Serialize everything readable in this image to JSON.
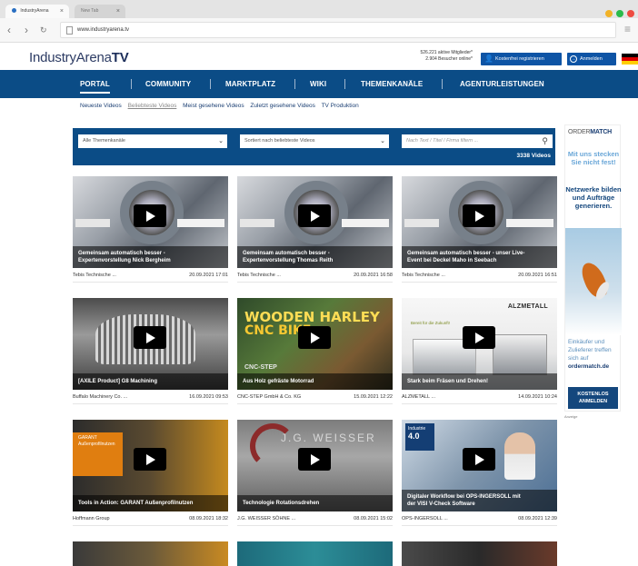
{
  "browser": {
    "tabs": [
      {
        "label": "IndustryArena"
      },
      {
        "label": "New Tab"
      }
    ],
    "url": "www.industryarena.tv",
    "window_buttons": [
      "#f2b227",
      "#2bbb4b",
      "#ee4b41"
    ]
  },
  "header": {
    "logo_text": "IndustryArena",
    "logo_suffix": "TV",
    "stats": {
      "members": "526.221 aktive Mitglieder*",
      "visitors": "2.904 Besucher online*"
    },
    "register_label": "Kostenfrei registrieren",
    "login_label": "Anmelden"
  },
  "nav": {
    "items": [
      {
        "label": "PORTAL"
      },
      {
        "label": "COMMUNITY"
      },
      {
        "label": "MARKTPLATZ"
      },
      {
        "label": "WIKI"
      },
      {
        "label": "THEMENKANÄLE"
      },
      {
        "label": "AGENTURLEISTUNGEN"
      }
    ],
    "active_index": 0
  },
  "subnav": {
    "items": [
      {
        "label": "Neueste Videos"
      },
      {
        "label": "Beliebteste Videos"
      },
      {
        "label": "Meist gesehene Videos"
      },
      {
        "label": "Zuletzt gesehene Videos"
      },
      {
        "label": "TV Produktion"
      }
    ],
    "active_index": 1
  },
  "filters": {
    "channel_select": "Alle Themenkanäle",
    "sort_select": "Sortiert nach beliebteste Videos",
    "search_placeholder": "Nach Text / Titel / Firma filtern ...",
    "video_count": "3338 Videos"
  },
  "videos": [
    {
      "title_line1": "Gemeinsam automatisch besser -",
      "title_line2": "Expertenvorstellung Nick Bergheim",
      "company": "Tebis Technische ...",
      "date": "20.09.2021 17:01"
    },
    {
      "title_line1": "Gemeinsam automatisch besser -",
      "title_line2": "Expertenvorstellung Thomas Reith",
      "company": "Tebis Technische ...",
      "date": "20.09.2021 16:58"
    },
    {
      "title_line1": "Gemeinsam automatisch besser - unser Live-",
      "title_line2": "Event bei Deckel Maho in Seebach",
      "company": "Tebis Technische ...",
      "date": "20.09.2021 16:51"
    },
    {
      "title_line1": "[AXILE Product] G8 Machining",
      "title_line2": "",
      "company": "Buffalo Machinery Co. ...",
      "date": "16.09.2021 09:53"
    },
    {
      "title_line1": "Aus Holz gefräste Motorrad",
      "title_line2": "",
      "company": "CNC-STEP GmbH & Co. KG",
      "date": "15.09.2021 12:22"
    },
    {
      "title_line1": "Stark beim Fräsen und Drehen!",
      "title_line2": "",
      "company": "ALZMETALL ...",
      "date": "14.09.2021 10:24"
    },
    {
      "title_line1": "Tools in Action: GARANT Außenprofilnutzen",
      "title_line2": "",
      "company": "Hoffmann Group",
      "date": "08.09.2021 18:32"
    },
    {
      "title_line1": "Technologie Rotationsdrehen",
      "title_line2": "",
      "company": "J.G. WEISSER SÖHNE ...",
      "date": "08.09.2021 15:02"
    },
    {
      "title_line1": "Digitaler Workflow bei OPS-INGERSOLL mit",
      "title_line2": "der VISI V-Check Software",
      "company": "OPS-INGERSOLL ...",
      "date": "08.09.2021 12:39"
    }
  ],
  "thumb_text": {
    "wooden_1": "WOODEN HARLEY",
    "wooden_2": "CNC BIKE",
    "wooden_3": "CNC-STEP",
    "alz_brand": "ALZMETALL",
    "alz_tag": "Bereit für die Zukunft!",
    "garant_1": "GARANT",
    "garant_2": "Außenprofilnutzen",
    "weisser": "J.G. WEISSER",
    "industrie_1": "Industrie",
    "industrie_2": "4.0"
  },
  "ad": {
    "brand_a": "ORDER",
    "brand_b": "MATCH",
    "promo_1": "Mit uns stecken Sie nicht fest!",
    "promo_2": "Netzwerke bilden und Aufträge generieren.",
    "text_1": "Einkäufer und Zulieferer treffen sich auf",
    "text_2": "ordermatch.de",
    "cta": "KOSTENLOS ANMELDEN",
    "label": "Anzeige"
  }
}
